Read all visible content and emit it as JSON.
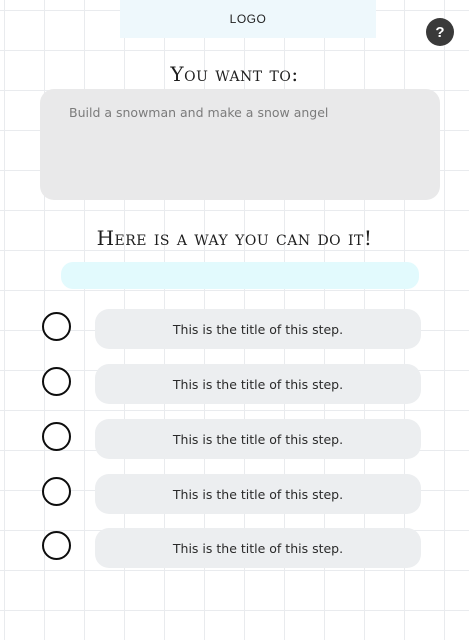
{
  "header": {
    "logo": "LOGO",
    "help_label": "?"
  },
  "goal": {
    "heading": "You want to:",
    "text": "Build a snowman and make a snow angel"
  },
  "plan": {
    "heading": "Here is a way you can do it!",
    "progress": 0
  },
  "steps": [
    {
      "title": "This is the title of this step.",
      "done": false
    },
    {
      "title": "This is the title of this step.",
      "done": false
    },
    {
      "title": "This is the title of this step.",
      "done": false
    },
    {
      "title": "This is the title of this step.",
      "done": false
    },
    {
      "title": "This is the title of this step.",
      "done": false
    }
  ],
  "colors": {
    "logo_bg": "#eef8fc",
    "progress_bg": "#e2fafd",
    "pill_bg": "#eceef0",
    "wish_box_bg": "#e9e9ea",
    "help_button_bg": "#3a3a3a"
  }
}
